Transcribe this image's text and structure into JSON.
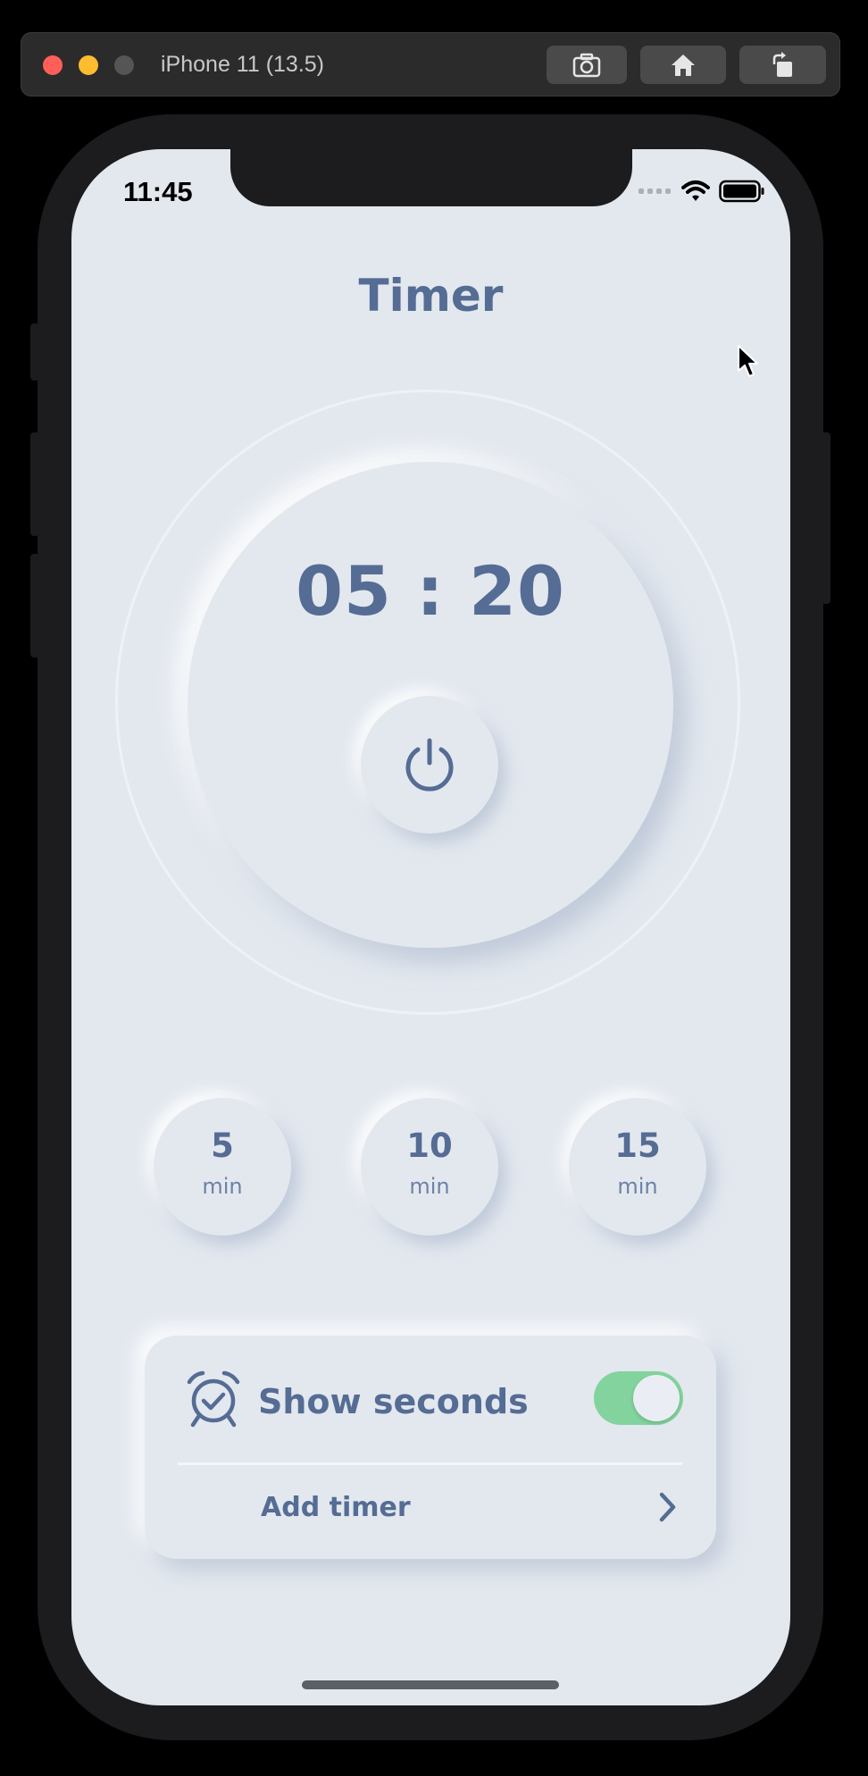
{
  "simulator": {
    "title": "iPhone 11 (13.5)",
    "buttons": [
      "screenshot",
      "home",
      "rotate"
    ]
  },
  "status_bar": {
    "time": "11:45"
  },
  "app": {
    "title": "Timer",
    "timer_display": "05 : 20",
    "presets": [
      {
        "value": "5",
        "unit": "min"
      },
      {
        "value": "10",
        "unit": "min"
      },
      {
        "value": "15",
        "unit": "min"
      }
    ],
    "settings": {
      "show_seconds_label": "Show seconds",
      "show_seconds_enabled": true,
      "add_timer_label": "Add timer"
    }
  },
  "colors": {
    "background": "#e3e8ef",
    "text": "#556c94",
    "toggle_on": "#82d39d"
  }
}
